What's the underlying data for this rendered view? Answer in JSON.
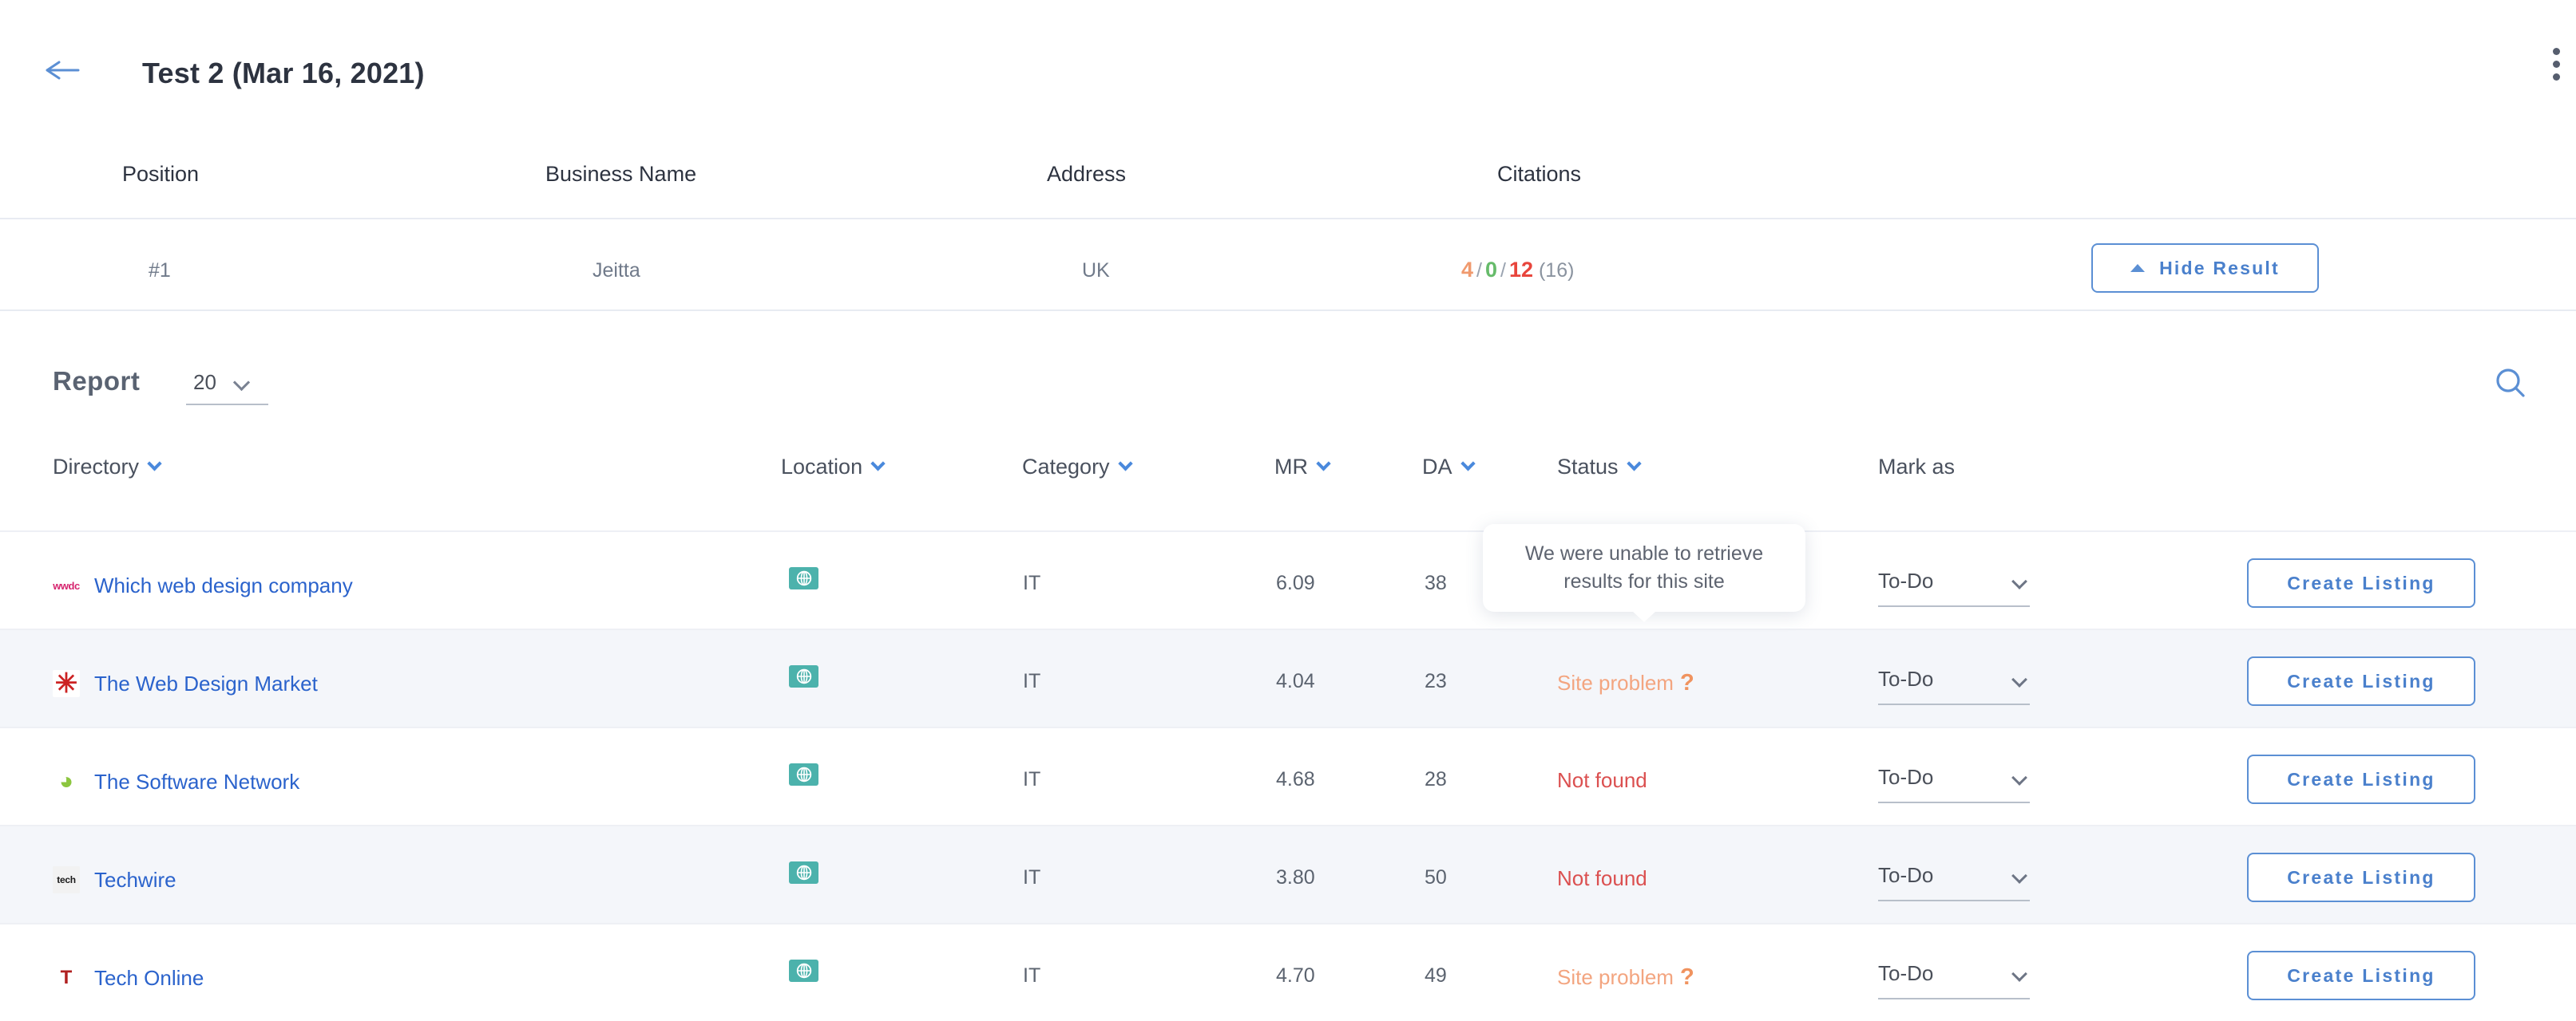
{
  "header": {
    "back_icon": "arrow-left-icon",
    "title": "Test 2  (Mar 16, 2021)",
    "menu_icon": "kebab-menu-icon"
  },
  "summary": {
    "columns": [
      "Position",
      "Business Name",
      "Address",
      "Citations"
    ],
    "row": {
      "position": "#1",
      "business_name": "Jeitta",
      "address": "UK",
      "citations": {
        "orange": "4",
        "green": "0",
        "red": "12",
        "total": "(16)",
        "separator": "/"
      }
    },
    "hide_result_label": "Hide Result",
    "hide_result_icon": "caret-up-icon"
  },
  "report": {
    "label": "Report",
    "page_size": "20",
    "page_size_icon": "chevron-down-icon",
    "search_icon": "search-icon",
    "columns": [
      {
        "label": "Directory",
        "sortable": true
      },
      {
        "label": "Location",
        "sortable": true
      },
      {
        "label": "Category",
        "sortable": true
      },
      {
        "label": "MR",
        "sortable": true
      },
      {
        "label": "DA",
        "sortable": true
      },
      {
        "label": "Status",
        "sortable": true
      },
      {
        "label": "Mark as",
        "sortable": false
      }
    ],
    "rows": [
      {
        "favicon": "wwdc-favicon",
        "favicon_text": "wwdc",
        "directory": "Which web design company",
        "location_icon": "globe-icon",
        "category": "IT",
        "mr": "6.09",
        "da": "38",
        "status": "",
        "status_type": "hidden",
        "mark_as": "To-Do",
        "action": "Create Listing"
      },
      {
        "favicon": "asterisk-favicon",
        "favicon_text": "✳",
        "directory": "The Web Design Market",
        "location_icon": "globe-icon",
        "category": "IT",
        "mr": "4.04",
        "da": "23",
        "status": "Site problem",
        "status_suffix": "?",
        "status_type": "problem",
        "mark_as": "To-Do",
        "action": "Create Listing"
      },
      {
        "favicon": "disc-favicon",
        "favicon_text": "◕",
        "directory": "The Software Network",
        "location_icon": "globe-icon",
        "category": "IT",
        "mr": "4.68",
        "da": "28",
        "status": "Not found",
        "status_suffix": "",
        "status_type": "notfound",
        "mark_as": "To-Do",
        "action": "Create Listing"
      },
      {
        "favicon": "techwire-favicon",
        "favicon_text": "tech",
        "directory": "Techwire",
        "location_icon": "globe-icon",
        "category": "IT",
        "mr": "3.80",
        "da": "50",
        "status": "Not found",
        "status_suffix": "",
        "status_type": "notfound",
        "mark_as": "To-Do",
        "action": "Create Listing"
      },
      {
        "favicon": "techonline-favicon",
        "favicon_text": "T",
        "directory": "Tech Online",
        "location_icon": "globe-icon",
        "category": "IT",
        "mr": "4.70",
        "da": "49",
        "status": "Site problem",
        "status_suffix": "?",
        "status_type": "problem",
        "mark_as": "To-Do",
        "action": "Create Listing"
      }
    ]
  },
  "tooltip": {
    "text": "We were unable to retrieve results for this site"
  },
  "colors": {
    "link_blue": "#2b63cc",
    "accent_blue": "#4a89dc",
    "button_blue": "#5b8fd4",
    "status_notfound": "#db5050",
    "status_problem": "#f3a580",
    "citation_orange": "#f09a6e",
    "citation_green": "#66bb6a",
    "citation_red": "#e8453c",
    "row_stripe": "#f4f6fa",
    "globe_teal": "#4cb2ac"
  }
}
